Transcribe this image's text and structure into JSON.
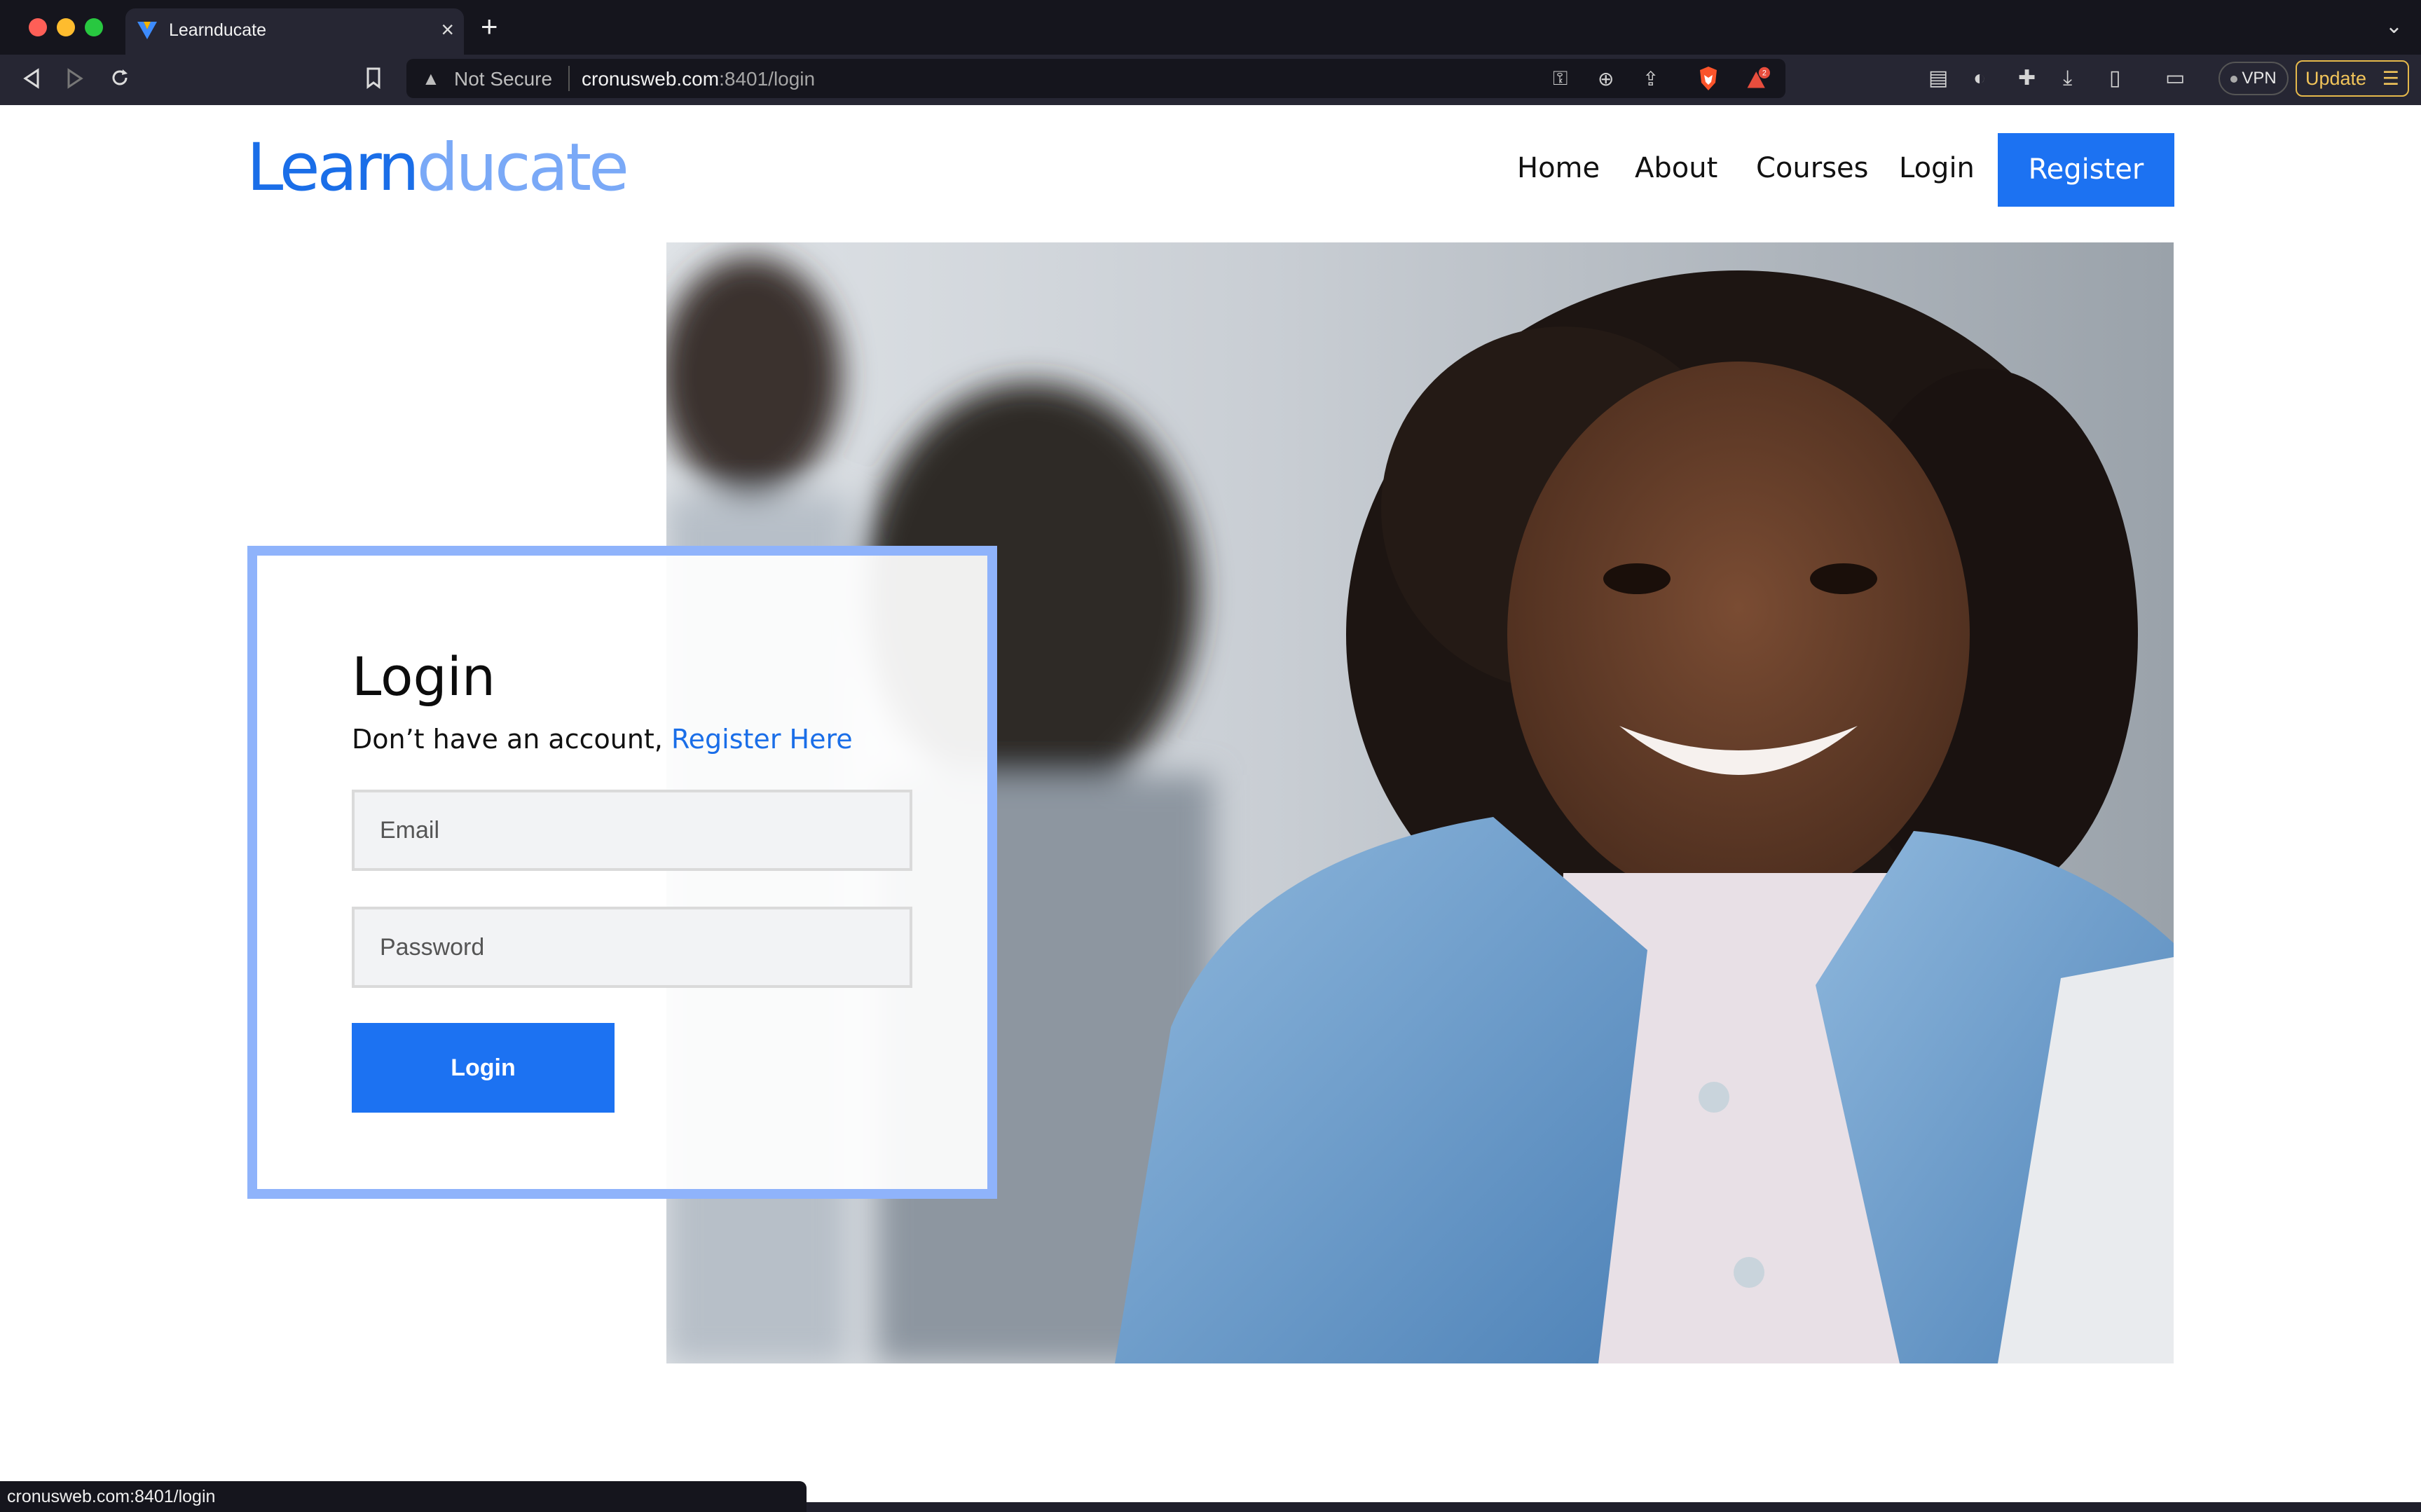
{
  "browser": {
    "tab_title": "Learnducate",
    "tab_close": "×",
    "new_tab": "+",
    "security_label": "Not Secure",
    "url_host": "cronusweb.com",
    "url_rest": ":8401/login",
    "shield_badge": "2",
    "vpn_label": "VPN",
    "update_label": "Update",
    "status_url": "cronusweb.com:8401/login"
  },
  "site": {
    "logo_part1": "Learn",
    "logo_part2": "ducate",
    "nav": [
      "Home",
      "About",
      "Courses",
      "Login"
    ],
    "register_label": "Register"
  },
  "login": {
    "title": "Login",
    "subtitle": "Don’t have an account,",
    "register_link": "Register Here",
    "email_placeholder": "Email",
    "password_placeholder": "Password",
    "button_label": "Login"
  },
  "colors": {
    "brand_blue": "#1c72f2",
    "logo_light": "#7aa9f7",
    "card_border": "#8fb3fb",
    "update_accent": "#e5b84b"
  }
}
